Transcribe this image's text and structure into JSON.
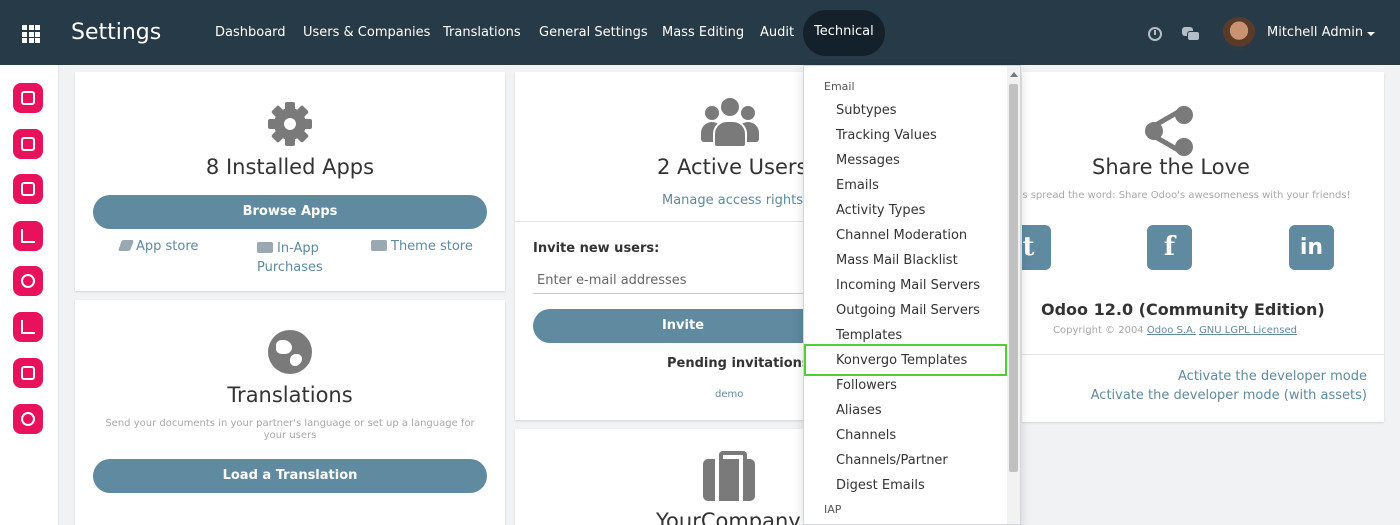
{
  "topbar": {
    "brand": "Settings",
    "menu": [
      "Dashboard",
      "Users & Companies",
      "Translations",
      "General Settings",
      "Mass Editing",
      "Audit",
      "Technical"
    ],
    "active_menu": "Technical",
    "user_name": "Mitchell Admin"
  },
  "sidebar": {
    "icons": [
      "discuss-icon",
      "calendar-icon",
      "contacts-icon",
      "crm-icon",
      "invoicing-icon",
      "sales-icon",
      "purchase-icon",
      "settings-icon"
    ],
    "accent": "#e8125c"
  },
  "apps_card": {
    "title": "8 Installed Apps",
    "button": "Browse Apps",
    "links": [
      "App store",
      "In-App Purchases",
      "Theme store"
    ]
  },
  "translations_card": {
    "title": "Translations",
    "description": "Send your documents in your partner's language or set up a language for your users",
    "button": "Load a Translation"
  },
  "users_card": {
    "title": "2 Active Users",
    "manage_link": "Manage access rights",
    "invite_label": "Invite new users:",
    "invite_placeholder": "Enter e-mail addresses",
    "invite_button": "Invite",
    "pending_label": "Pending invitations:",
    "pending_user": "demo"
  },
  "company_card": {
    "title": "YourCompany"
  },
  "share_card": {
    "title": "Share the Love",
    "subtitle": "Help us spread the word: Share Odoo's awesomeness with your friends!",
    "subtitle_visible": "us spread the word: Share Odoo's awesomeness with your friends!",
    "social": [
      "twitter",
      "facebook",
      "linkedin"
    ],
    "version": "Odoo 12.0 (Community Edition)",
    "copyright": "Copyright © 2004",
    "copyright_link": "Odoo S.A.",
    "license_link": "GNU LGPL Licensed",
    "dev_mode": "Activate the developer mode",
    "dev_mode_assets": "Activate the developer mode (with assets)"
  },
  "technical_dropdown": {
    "section_email": "Email",
    "items": [
      "Subtypes",
      "Tracking Values",
      "Messages",
      "Emails",
      "Activity Types",
      "Channel Moderation",
      "Mass Mail Blacklist",
      "Incoming Mail Servers",
      "Outgoing Mail Servers",
      "Templates",
      "Konvergo Templates",
      "Followers",
      "Aliases",
      "Channels",
      "Channels/Partner",
      "Digest Emails"
    ],
    "highlighted_item": "Konvergo Templates",
    "section_iap": "IAP",
    "highlight_color": "#4fce36"
  },
  "colors": {
    "navbar": "#263a47",
    "primary_button": "#5f8aa0",
    "background": "#f0f2f4"
  }
}
